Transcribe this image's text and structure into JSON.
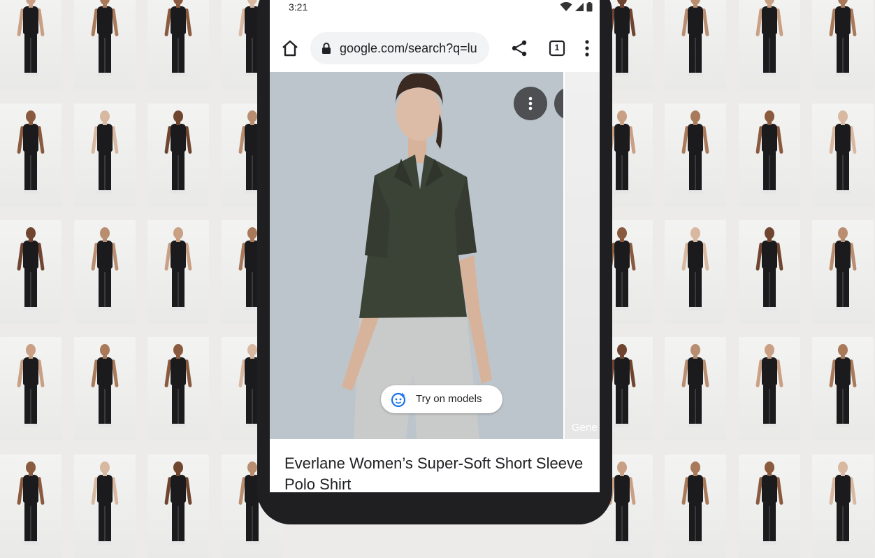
{
  "status_bar": {
    "time": "3:21"
  },
  "address_bar": {
    "url": "google.com/search?q=lu",
    "tab_count": "1"
  },
  "next_image": {
    "caption": "Gene"
  },
  "try_on": {
    "label": "Try on models"
  },
  "product": {
    "title": "Everlane Women’s Super-Soft Short Sleeve Polo Shirt"
  },
  "colors": {
    "shirt": "#3b4236",
    "backdrop": "#bcc5cb",
    "accent": "#1a73e8"
  }
}
